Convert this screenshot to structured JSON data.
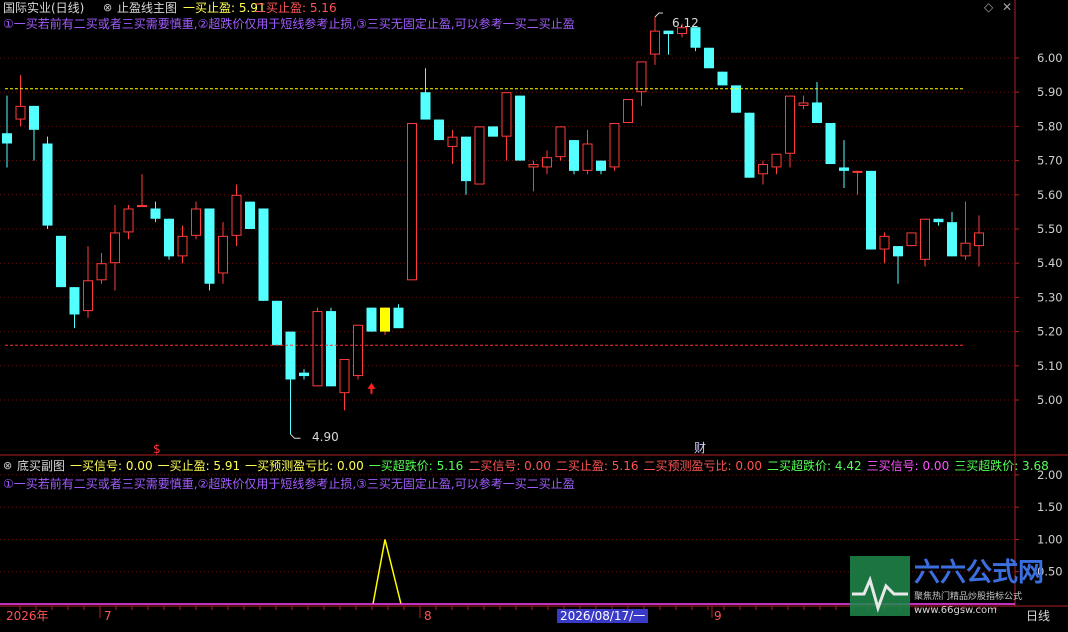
{
  "main_panel": {
    "title": "国际实业(日线)",
    "indicator": "止盈线主图",
    "stop1_label": "一买止盈: 5.91",
    "stop2_label": "二买止盈: 5.16",
    "note": "①一买若前有二买或者三买需要慎重,②超跌价仅用于短线参考止损,③三买无固定止盈,可以参考一买二买止盈",
    "high_label": "6.12",
    "low_label": "4.90",
    "marker_s": "$",
    "marker_cai": "财"
  },
  "sub_panel": {
    "title": "底买副图",
    "items": [
      {
        "text": "一买信号: 0.00",
        "color": "#ffff54"
      },
      {
        "text": "一买止盈: 5.91",
        "color": "#ffff54"
      },
      {
        "text": "一买预测盈亏比: 0.00",
        "color": "#ffff54"
      },
      {
        "text": "一买超跌价: 5.16",
        "color": "#54ff54"
      },
      {
        "text": "二买信号: 0.00",
        "color": "#ff5454"
      },
      {
        "text": "二买止盈: 5.16",
        "color": "#ff5454"
      },
      {
        "text": "二买预测盈亏比: 0.00",
        "color": "#ff5454"
      },
      {
        "text": "二买超跌价: 4.42",
        "color": "#54ff54"
      },
      {
        "text": "三买信号: 0.00",
        "color": "#ff54ff"
      },
      {
        "text": "三买超跌价: 3.68",
        "color": "#54ff54"
      }
    ],
    "note": "①一买若前有二买或者三买需要慎重,②超跌价仅用于短线参考止损,③三买无固定止盈,可以参考一买二买止盈"
  },
  "date_axis": {
    "year": "2026年",
    "m7": "7",
    "m8": "8",
    "cursor_date": "2026/08/17/一",
    "m9": "9",
    "period": "日线"
  },
  "watermark": {
    "name": "六六公式网",
    "slogan": "聚焦热门精品炒股指标公式",
    "url": "www.66gsw.com"
  },
  "colors": {
    "up": "#ff3c3c",
    "down": "#54ffff",
    "stop1_line": "#ffff00",
    "stop2_line": "#ff3030",
    "signal": "#ffff00",
    "note": "#a25cff"
  },
  "chart_data": [
    {
      "type": "candlestick",
      "ylim": [
        4.85,
        6.18
      ],
      "y_ticks": [
        5.0,
        5.1,
        5.2,
        5.3,
        5.4,
        5.5,
        5.6,
        5.7,
        5.8,
        5.9,
        6.0
      ],
      "reference_lines": [
        {
          "name": "一买止盈",
          "value": 5.91
        },
        {
          "name": "二买止盈",
          "value": 5.16
        }
      ],
      "ohlc": [
        [
          5.78,
          5.89,
          5.68,
          5.75
        ],
        [
          5.82,
          5.95,
          5.8,
          5.86
        ],
        [
          5.86,
          5.86,
          5.7,
          5.79
        ],
        [
          5.75,
          5.77,
          5.5,
          5.51
        ],
        [
          5.48,
          5.48,
          5.33,
          5.33
        ],
        [
          5.33,
          5.33,
          5.21,
          5.25
        ],
        [
          5.26,
          5.45,
          5.24,
          5.35
        ],
        [
          5.35,
          5.43,
          5.34,
          5.4
        ],
        [
          5.4,
          5.57,
          5.32,
          5.49
        ],
        [
          5.49,
          5.57,
          5.47,
          5.56
        ],
        [
          5.57,
          5.66,
          5.57,
          5.57
        ],
        [
          5.56,
          5.58,
          5.52,
          5.53
        ],
        [
          5.53,
          5.53,
          5.41,
          5.42
        ],
        [
          5.42,
          5.51,
          5.4,
          5.48
        ],
        [
          5.48,
          5.58,
          5.47,
          5.56
        ],
        [
          5.56,
          5.56,
          5.32,
          5.34
        ],
        [
          5.37,
          5.52,
          5.34,
          5.48
        ],
        [
          5.48,
          5.63,
          5.45,
          5.6
        ],
        [
          5.58,
          5.58,
          5.5,
          5.5
        ],
        [
          5.56,
          5.56,
          5.29,
          5.29
        ],
        [
          5.29,
          5.29,
          5.16,
          5.16
        ],
        [
          5.2,
          5.2,
          4.9,
          5.06
        ],
        [
          5.08,
          5.09,
          5.06,
          5.07
        ],
        [
          5.04,
          5.27,
          5.04,
          5.26
        ],
        [
          5.26,
          5.27,
          5.04,
          5.04
        ],
        [
          5.02,
          5.12,
          4.97,
          5.12
        ],
        [
          5.07,
          5.22,
          5.06,
          5.22
        ],
        [
          5.27,
          5.27,
          5.2,
          5.2
        ],
        [
          5.21,
          5.27,
          5.19,
          5.27
        ],
        [
          5.27,
          5.28,
          5.21,
          5.21
        ],
        [
          5.35,
          5.81,
          5.35,
          5.81
        ],
        [
          5.9,
          5.97,
          5.82,
          5.82
        ],
        [
          5.82,
          5.82,
          5.76,
          5.76
        ],
        [
          5.74,
          5.79,
          5.69,
          5.77
        ],
        [
          5.77,
          5.77,
          5.6,
          5.64
        ],
        [
          5.63,
          5.8,
          5.63,
          5.8
        ],
        [
          5.8,
          5.8,
          5.77,
          5.77
        ],
        [
          5.77,
          5.9,
          5.7,
          5.9
        ],
        [
          5.89,
          5.89,
          5.7,
          5.7
        ],
        [
          5.68,
          5.7,
          5.61,
          5.69
        ],
        [
          5.68,
          5.73,
          5.66,
          5.71
        ],
        [
          5.71,
          5.8,
          5.7,
          5.8
        ],
        [
          5.76,
          5.76,
          5.66,
          5.67
        ],
        [
          5.67,
          5.79,
          5.66,
          5.75
        ],
        [
          5.7,
          5.7,
          5.66,
          5.67
        ],
        [
          5.68,
          5.81,
          5.67,
          5.81
        ],
        [
          5.81,
          5.88,
          5.81,
          5.88
        ],
        [
          5.9,
          5.99,
          5.86,
          5.99
        ],
        [
          6.01,
          6.12,
          5.98,
          6.08
        ],
        [
          6.08,
          6.08,
          6.01,
          6.07
        ],
        [
          6.07,
          6.1,
          6.06,
          6.09
        ],
        [
          6.09,
          6.09,
          6.02,
          6.03
        ],
        [
          6.03,
          6.03,
          5.97,
          5.97
        ],
        [
          5.96,
          5.96,
          5.92,
          5.92
        ],
        [
          5.92,
          5.92,
          5.84,
          5.84
        ],
        [
          5.84,
          5.84,
          5.65,
          5.65
        ],
        [
          5.66,
          5.7,
          5.63,
          5.69
        ],
        [
          5.68,
          5.72,
          5.66,
          5.72
        ],
        [
          5.72,
          5.89,
          5.68,
          5.89
        ],
        [
          5.86,
          5.89,
          5.85,
          5.87
        ],
        [
          5.87,
          5.93,
          5.81,
          5.81
        ],
        [
          5.81,
          5.81,
          5.69,
          5.69
        ],
        [
          5.68,
          5.76,
          5.62,
          5.67
        ],
        [
          5.67,
          5.67,
          5.6,
          5.67
        ],
        [
          5.67,
          5.67,
          5.44,
          5.44
        ],
        [
          5.44,
          5.49,
          5.4,
          5.48
        ],
        [
          5.45,
          5.45,
          5.34,
          5.42
        ],
        [
          5.45,
          5.49,
          5.45,
          5.49
        ],
        [
          5.41,
          5.53,
          5.39,
          5.53
        ],
        [
          5.53,
          5.53,
          5.51,
          5.52
        ],
        [
          5.52,
          5.55,
          5.42,
          5.42
        ],
        [
          5.42,
          5.58,
          5.41,
          5.46
        ],
        [
          5.45,
          5.54,
          5.39,
          5.49
        ]
      ]
    },
    {
      "type": "line",
      "series": [
        {
          "values": [
            0,
            0,
            0,
            0,
            0,
            0,
            0,
            0,
            0,
            0,
            0,
            0,
            0,
            0,
            0,
            0,
            0,
            0,
            0,
            0,
            0,
            0,
            0,
            0,
            0,
            0,
            0,
            0,
            1,
            0,
            0,
            0,
            0,
            0,
            0,
            0,
            0,
            0,
            0,
            0,
            0,
            0,
            0,
            0,
            0,
            0,
            0,
            0,
            0,
            0,
            0,
            0,
            0,
            0,
            0,
            0,
            0,
            0,
            0,
            0,
            0,
            0,
            0,
            0,
            0,
            0,
            0,
            0,
            0,
            0,
            0,
            0,
            0
          ]
        }
      ],
      "ylim": [
        0,
        2.2
      ],
      "y_ticks": [
        0.5,
        1.0,
        1.5,
        2.0
      ]
    }
  ]
}
